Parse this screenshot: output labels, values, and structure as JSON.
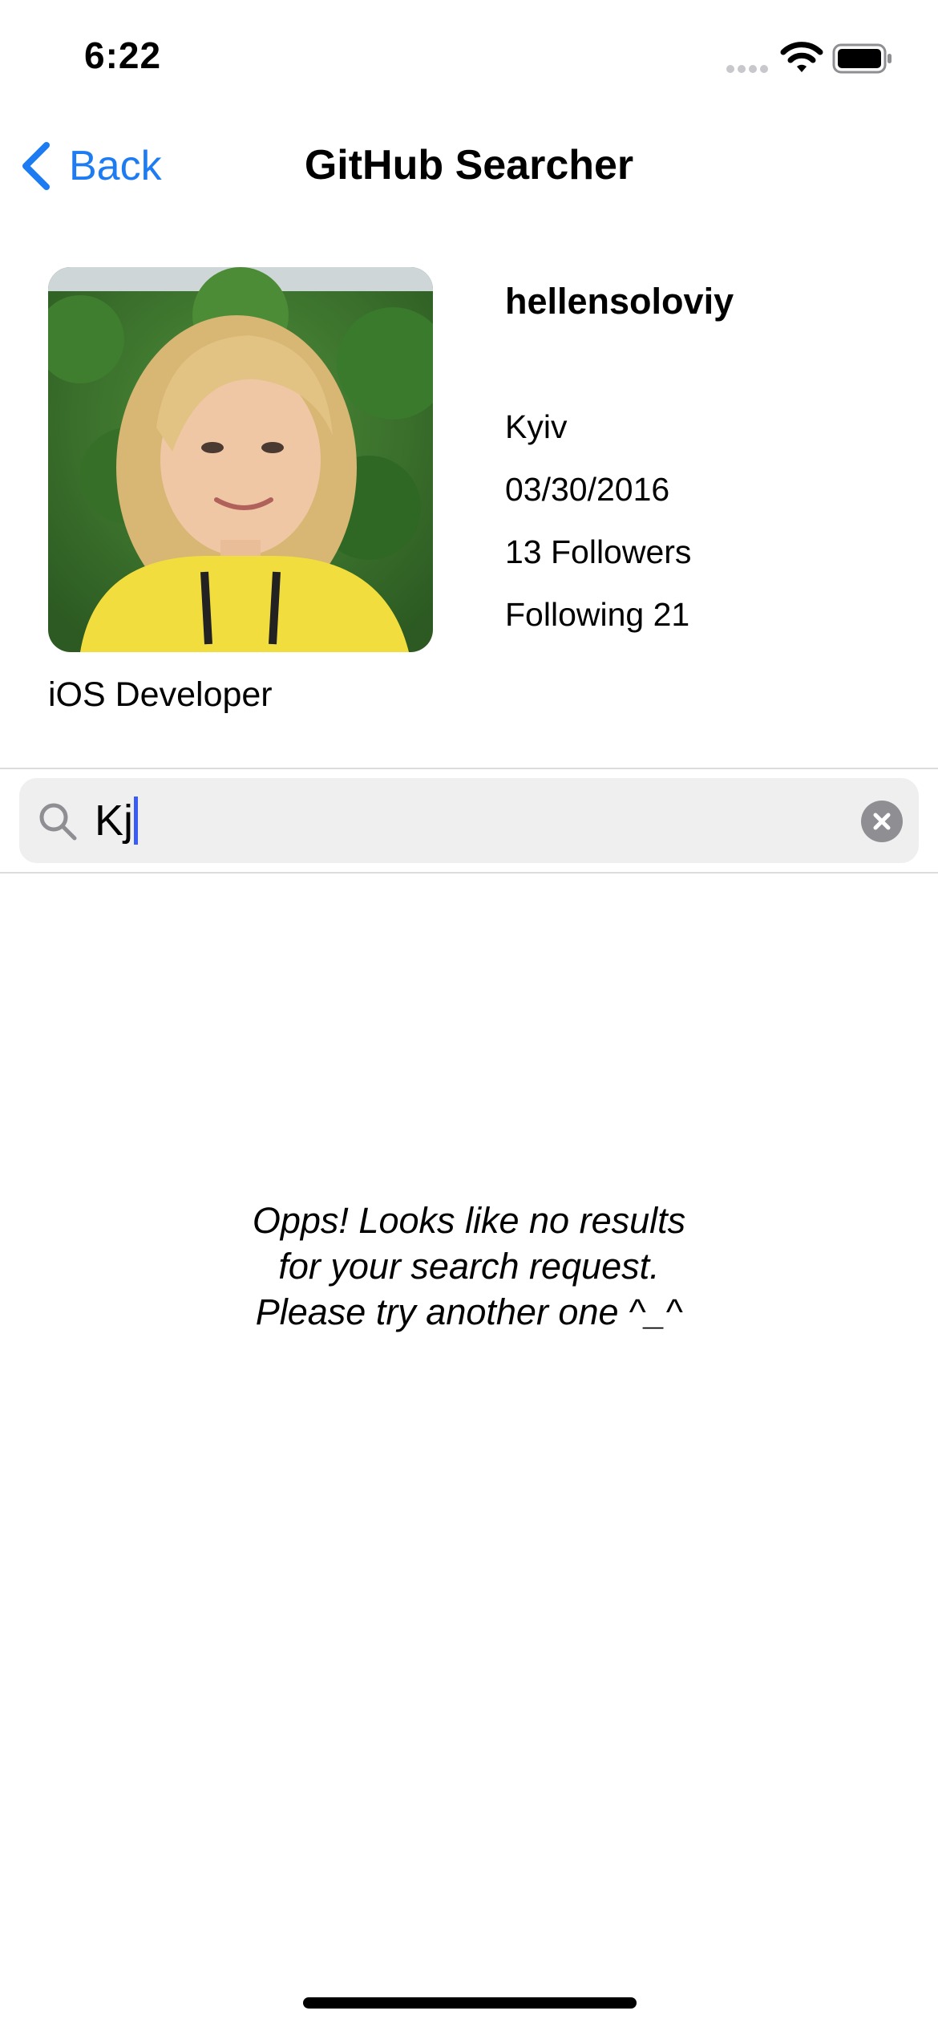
{
  "status_bar": {
    "time": "6:22"
  },
  "nav": {
    "back_label": "Back",
    "title": "GitHub Searcher",
    "accent_color": "#1d7cf2"
  },
  "profile": {
    "username": "hellensoloviy",
    "location": "Kyiv",
    "joined": "03/30/2016",
    "followers": "13 Followers",
    "following": "Following 21",
    "bio": "iOS Developer"
  },
  "search": {
    "value": "Kj"
  },
  "empty_state": {
    "lines": [
      "Opps! Looks like no results",
      "for your search request.",
      "Please try another one ^_^"
    ]
  },
  "icons": {
    "back": "chevron-left-icon",
    "search": "magnifying-glass-icon",
    "clear": "close-circle-icon",
    "wifi": "wifi-icon",
    "battery": "battery-icon"
  }
}
